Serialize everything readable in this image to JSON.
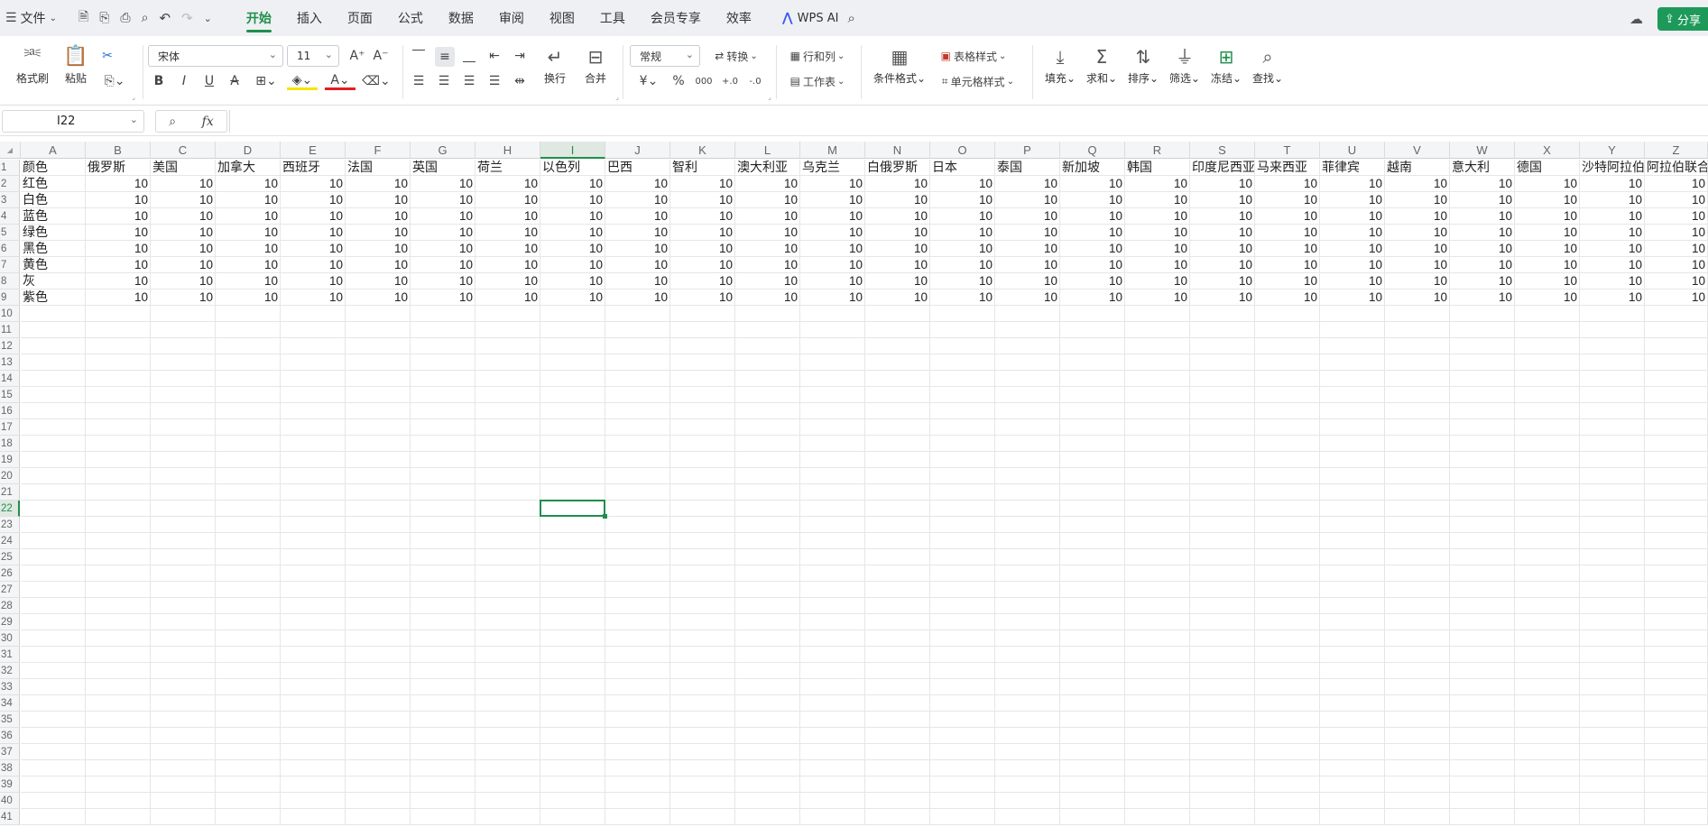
{
  "menubar": {
    "file_label": "文件",
    "tabs": [
      "开始",
      "插入",
      "页面",
      "公式",
      "数据",
      "审阅",
      "视图",
      "工具",
      "会员专享",
      "效率"
    ],
    "active_tab": "开始",
    "wps_ai_label": "WPS AI",
    "share_label": "分享"
  },
  "ribbon": {
    "format_painter": "格式刷",
    "paste": "粘贴",
    "font_name": "宋体",
    "font_size": "11",
    "wrap": "换行",
    "merge": "合并",
    "number_format": "常规",
    "convert": "转换",
    "rows_cols": "行和列",
    "worksheet": "工作表",
    "cond_format": "条件格式",
    "table_style": "表格样式",
    "cell_style": "单元格样式",
    "fill": "填充",
    "sum": "求和",
    "sort": "排序",
    "filter": "筛选",
    "freeze": "冻结",
    "find": "查找",
    "currency_symbol": "¥",
    "percent_symbol": "%",
    "thousands_symbol": "000"
  },
  "formula_bar": {
    "cell_ref": "I22",
    "fx": "fx",
    "formula": ""
  },
  "sheet": {
    "active_cell": "I22",
    "columns": [
      "A",
      "B",
      "C",
      "D",
      "E",
      "F",
      "G",
      "H",
      "I",
      "J",
      "K",
      "L",
      "M",
      "N",
      "O",
      "P",
      "Q",
      "R",
      "S",
      "T",
      "U",
      "V",
      "W",
      "X",
      "Y",
      "Z"
    ],
    "header_row": [
      "颜色",
      "俄罗斯",
      "美国",
      "加拿大",
      "西班牙",
      "法国",
      "英国",
      "荷兰",
      "以色列",
      "巴西",
      "智利",
      "澳大利亚",
      "乌克兰",
      "白俄罗斯",
      "日本",
      "泰国",
      "新加坡",
      "韩国",
      "印度尼西亚",
      "马来西亚",
      "菲律宾",
      "越南",
      "意大利",
      "德国",
      "沙特阿拉伯",
      "阿拉伯联合酋长国"
    ],
    "row_labels": [
      "红色",
      "白色",
      "蓝色",
      "绿色",
      "黑色",
      "黄色",
      "灰",
      "紫色"
    ],
    "cell_value": "10",
    "row_count": 41
  }
}
